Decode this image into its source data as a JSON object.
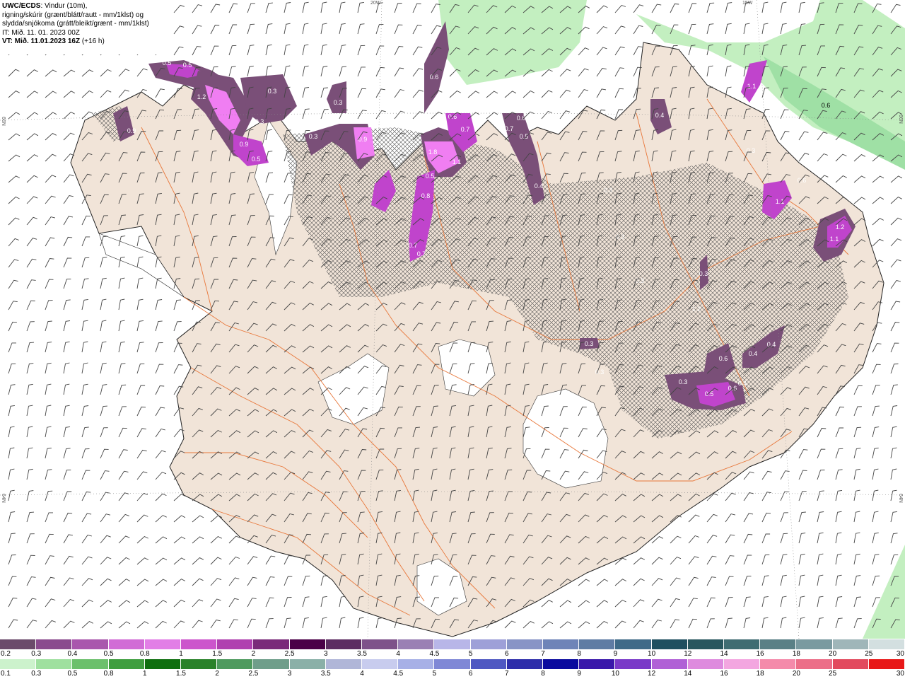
{
  "header": {
    "model": "UWC/ECDS",
    "line1": ": Vindur (10m),",
    "line2": "rigning/skúrir (grænt/blátt/rautt - mm/1klst) og",
    "line3": "slydda/snjókoma (grátt/bleikt/grænt - mm/1klst)",
    "init_time": "IT: Mið. 11. 01. 2023 00Z",
    "valid_label": "VT: Mið. 11.01.2023 16Z",
    "valid_offset": " (+16 h)"
  },
  "grid_labels": {
    "lon_20w": "20W",
    "lon_15w": "15W",
    "lat_66n_left": "66N",
    "lat_66n_right": "66N",
    "lat_64n_left": "64N",
    "lat_64n_right": "64N"
  },
  "precip_labels": [
    "0.5",
    "0.5",
    "0.4",
    "1.2",
    "0.3",
    "0.3",
    "0.9",
    "0.3",
    "0.9",
    "0.5",
    "0.3",
    "0.9",
    "0.6",
    "0.7",
    "0.6",
    "0.7",
    "0.7",
    "0.6",
    "0.5",
    "1.8",
    "0.5",
    "1.1",
    "0.8",
    "0.7",
    "0.7",
    "0.4",
    "1.1",
    "0.6",
    "0.4",
    "0.3",
    "0.3",
    "0.3",
    "1.2",
    "0.4",
    "0.3",
    "0.4",
    "0.6",
    "0.4",
    "0.3",
    "0.5",
    "0.6",
    "1.1",
    "1.2",
    "1.1",
    "0.4",
    "0.3",
    "0.3",
    "0.6",
    "0.3"
  ],
  "legend_snow": {
    "colors": [
      "#6b4a6b",
      "#8a4a8e",
      "#a957ad",
      "#d16cd6",
      "#e27ee6",
      "#cc55cc",
      "#b040b0",
      "#7a2a7a",
      "#4a0048",
      "#5c2c62",
      "#7e528a",
      "#9a80b4",
      "#b8b6e8",
      "#9ea0d8",
      "#8894c6",
      "#6f84b8",
      "#5f7ca4",
      "#3f6a88",
      "#1f4f60",
      "#28565e",
      "#3f6c72",
      "#5a8086",
      "#7a9aa0",
      "#9fb6b9",
      "#d3dfe0"
    ],
    "labels": [
      "0.2",
      "0.3",
      "0.4",
      "0.5",
      "0.8",
      "1",
      "1.5",
      "2",
      "2.5",
      "3",
      "3.5",
      "4",
      "4.5",
      "5",
      "6",
      "7",
      "8",
      "9",
      "10",
      "12",
      "14",
      "16",
      "18",
      "20",
      "25",
      "30"
    ]
  },
  "legend_rain": {
    "colors": [
      "#ccf2cc",
      "#9fe09f",
      "#6cc06c",
      "#3f9e3f",
      "#0f6f0f",
      "#2a822a",
      "#4e9a5e",
      "#6f9e8a",
      "#8ab0a8",
      "#b0b6d8",
      "#c8ccee",
      "#a7b0e6",
      "#7f88d6",
      "#4f58c2",
      "#2e2eaa",
      "#0a0a9e",
      "#3a18aa",
      "#7a3ac8",
      "#b060d6",
      "#de8ade",
      "#f3a6e0",
      "#f48aaa",
      "#ec6e88",
      "#e24a5e",
      "#e81818"
    ],
    "labels": [
      "0.1",
      "0.3",
      "0.5",
      "0.8",
      "1",
      "1.5",
      "2",
      "2.5",
      "3",
      "3.5",
      "4",
      "4.5",
      "5",
      "6",
      "7",
      "8",
      "9",
      "10",
      "12",
      "14",
      "16",
      "18",
      "20",
      "25",
      "30"
    ]
  },
  "colors": {
    "land": "#f1e4d8",
    "snow_zone": "#ffffff",
    "roads": "#e8773a",
    "coast": "#222222",
    "rain_band": "#b8ecb6",
    "rain_band_dark": "#8fd79a",
    "snow_light": "#7a4f78",
    "snow_mid": "#c044cc",
    "snow_high": "#f07ef2",
    "barbs": "#444444",
    "hatch": "#3a3a3a"
  }
}
